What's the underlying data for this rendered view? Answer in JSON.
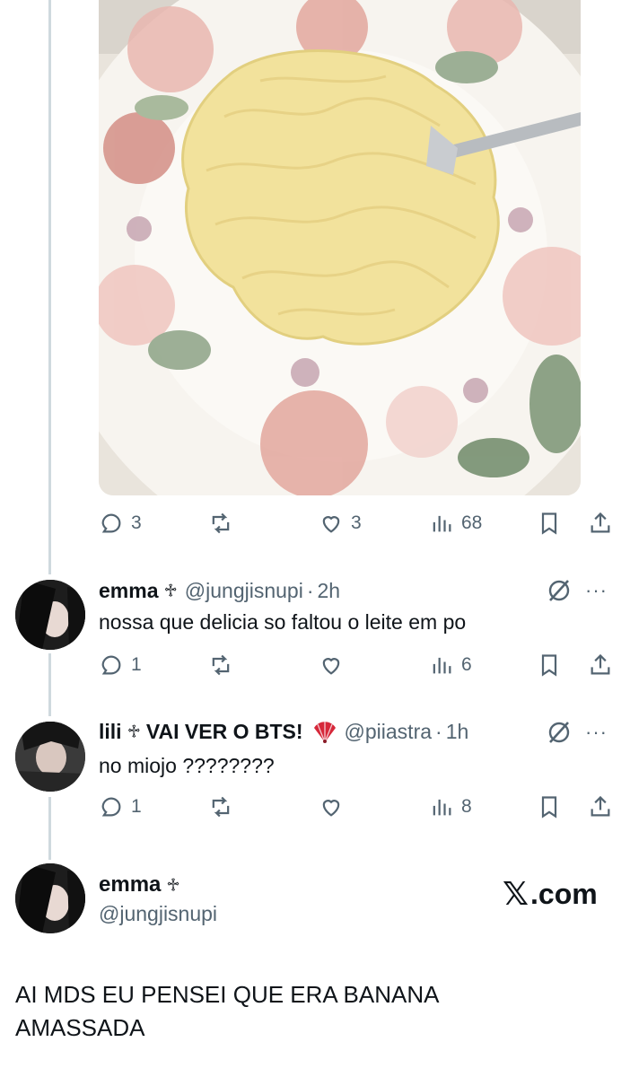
{
  "post": {
    "image_alt": "plate of creamy instant noodles on a floral plate with a fork",
    "actions": {
      "replies": "3",
      "reposts": "",
      "likes": "3",
      "views": "68"
    }
  },
  "replies": [
    {
      "name": "emma",
      "cross": "♱",
      "handle": "@jungjisnupi",
      "dot": "·",
      "time": "2h",
      "text": "nossa que delicia so faltou o leite em po",
      "actions": {
        "replies": "1",
        "views": "6"
      }
    },
    {
      "name": "lili",
      "cross": "♱",
      "name_suffix": "VAI VER O BTS!",
      "emoji": "folding-fan",
      "handle": "@piiastra",
      "dot": "·",
      "time": "1h",
      "text": "no miojo ????????",
      "actions": {
        "replies": "1",
        "views": "8"
      }
    }
  ],
  "quote": {
    "name": "emma",
    "cross": "♱",
    "handle": "@jungjisnupi",
    "brand": ".com",
    "brand_glyph": "𝕏",
    "text": "AI MDS EU PENSEI QUE ERA BANANA AMASSADA"
  },
  "more_glyph": "···",
  "colors": {
    "secondary": "#536471",
    "text": "#0f1419",
    "thread_line": "#cfd9de"
  }
}
